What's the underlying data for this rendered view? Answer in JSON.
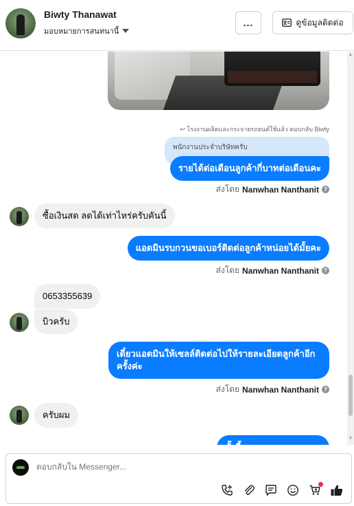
{
  "header": {
    "name": "Biwty Thanawat",
    "assign_label": "มอบหมายการสนทนานี้",
    "more_label": "...",
    "contact_button": "ดูข้อมูลติดต่อ"
  },
  "thread": {
    "reply_note": "โรงงานผลิตและกระจายรถยนต์ใช้แล้ว ตอบกลับ Biwty",
    "quoted_text": "พนักงานประจำบริษัทครับ",
    "messages": [
      {
        "direction": "out",
        "text": "รายได้ต่อเดือนลูกค้ากี่บาทต่อเดือนคะ"
      },
      {
        "direction": "in",
        "text": "ซื้อเงินสด ลดได้เท่าไหร่ครับคันนี้"
      },
      {
        "direction": "out",
        "text": "แอดมินรบกวนขอเบอร์ติดต่อลูกค้าหน่อยได้มั้ยคะ"
      },
      {
        "direction": "in",
        "text": "0653355639"
      },
      {
        "direction": "in",
        "text": "บิวครับ"
      },
      {
        "direction": "out",
        "text": "เดี๋ยวแอดมินให้เซลล์ติดต่อไปให้รายละเอียดลูกค้าอีกครั้งค่ะ"
      },
      {
        "direction": "in",
        "text": "ครับผม"
      },
      {
        "direction": "out",
        "text": "ทั้งนี้ ...ร..."
      }
    ],
    "sent_by_prefix": "ส่งโดย",
    "sent_by_name": "Nanwhan Nanthanit"
  },
  "composer": {
    "placeholder": "ตอบกลับใน Messenger...",
    "icons": [
      "call-add-icon",
      "attachment-icon",
      "saved-reply-icon",
      "emoji-icon",
      "cart-icon",
      "like-icon"
    ]
  },
  "colors": {
    "outgoing_bubble": "#0a7cff",
    "incoming_bubble": "#f0f0f0",
    "notification_dot": "#f02849"
  }
}
